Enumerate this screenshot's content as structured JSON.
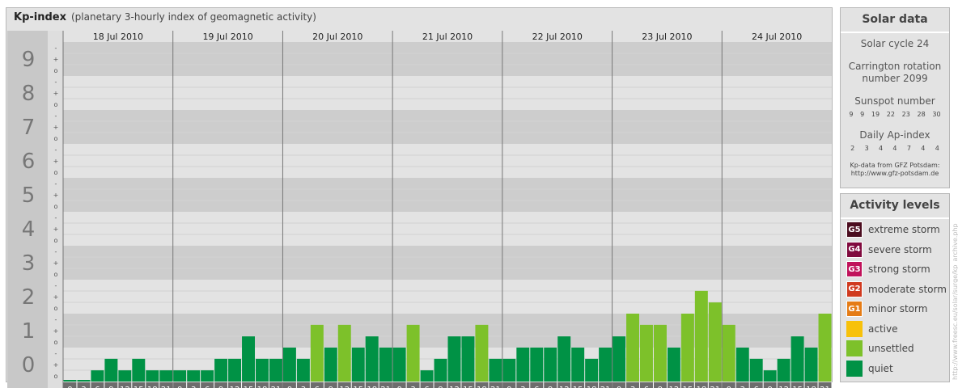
{
  "header": {
    "title": "Kp-index",
    "subtitle": "(planetary 3-hourly index of geomagnetic activity)"
  },
  "chart_data": {
    "type": "bar",
    "title": "Kp-index",
    "subtitle": "(planetary 3-hourly index of geomagnetic activity)",
    "ylim": [
      0,
      9
    ],
    "y_ticks": [
      "0",
      "1",
      "2",
      "3",
      "4",
      "5",
      "6",
      "7",
      "8",
      "9"
    ],
    "sub_ticks": [
      "o",
      "+",
      "-"
    ],
    "dates": [
      "18 Jul 2010",
      "19 Jul 2010",
      "20 Jul 2010",
      "21 Jul 2010",
      "22 Jul 2010",
      "23 Jul 2010",
      "24 Jul 2010"
    ],
    "hour_start": [
      "0",
      "3",
      "6",
      "9",
      "12",
      "15",
      "18",
      "21"
    ],
    "hour_end": [
      "3",
      "6",
      "9",
      "12",
      "15",
      "18",
      "21",
      "24"
    ],
    "values": [
      0.0,
      0.0,
      0.33,
      0.67,
      0.33,
      0.67,
      0.33,
      0.33,
      0.33,
      0.33,
      0.33,
      0.67,
      0.67,
      1.33,
      0.67,
      0.67,
      1.0,
      0.67,
      1.67,
      1.0,
      1.67,
      1.0,
      1.33,
      1.0,
      1.0,
      1.67,
      0.33,
      0.67,
      1.33,
      1.33,
      1.67,
      0.67,
      0.67,
      1.0,
      1.0,
      1.0,
      1.33,
      1.0,
      0.67,
      1.0,
      1.33,
      2.0,
      1.67,
      1.67,
      1.0,
      2.0,
      2.67,
      2.33,
      1.67,
      1.0,
      0.67,
      0.33,
      0.67,
      1.33,
      1.0,
      2.0
    ],
    "colors": {
      "quiet": "#009245",
      "unsettled": "#7dc12a",
      "band_dark": "#cdcdcd",
      "band_light": "#e3e3e3",
      "gutter": "#c8c8c8",
      "hour_cell": "#6d6d6d"
    }
  },
  "solar": {
    "title": "Solar data",
    "cycle": "Solar cycle 24",
    "carrington_1": "Carrington rotation",
    "carrington_2": "number 2099",
    "sunspot_title": "Sunspot number",
    "sunspot_values": [
      "9",
      "9",
      "19",
      "22",
      "23",
      "28",
      "30"
    ],
    "ap_title": "Daily Ap-index",
    "ap_values": [
      "2",
      "3",
      "4",
      "4",
      "7",
      "4",
      "4"
    ],
    "source_1": "Kp-data from GFZ Potsdam:",
    "source_2": "http://www.gfz-potsdam.de"
  },
  "activity": {
    "title": "Activity levels",
    "items": [
      {
        "badge": "G5",
        "label": "extreme storm",
        "color": "#4b0d1f"
      },
      {
        "badge": "G4",
        "label": "severe storm",
        "color": "#800a3e"
      },
      {
        "badge": "G3",
        "label": "strong storm",
        "color": "#c0125a"
      },
      {
        "badge": "G2",
        "label": "moderate storm",
        "color": "#d03a1f"
      },
      {
        "badge": "G1",
        "label": "minor storm",
        "color": "#e57c16"
      },
      {
        "badge": "",
        "label": "active",
        "color": "#f7c10a"
      },
      {
        "badge": "",
        "label": "unsettled",
        "color": "#7dc12a"
      },
      {
        "badge": "",
        "label": "quiet",
        "color": "#009245"
      }
    ]
  },
  "watermark": "http://www.freesc.eu/solar/surge/kp_archive.php"
}
